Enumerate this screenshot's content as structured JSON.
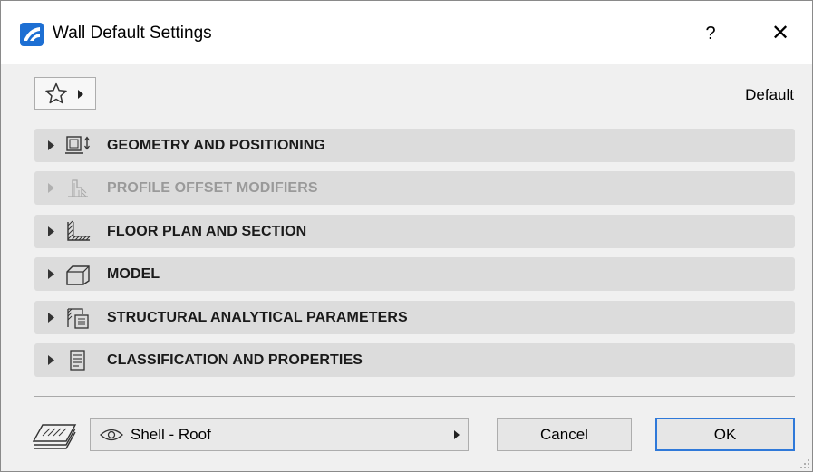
{
  "window": {
    "title": "Wall Default Settings",
    "help_label": "?",
    "close_label": "✕",
    "app_icon": "archicad-logo-icon"
  },
  "header": {
    "favorites_icon": "star-icon",
    "preset_label": "Default"
  },
  "panels": [
    {
      "label": "GEOMETRY AND POSITIONING",
      "icon": "geometry-icon",
      "enabled": true
    },
    {
      "label": "PROFILE OFFSET MODIFIERS",
      "icon": "profile-offset-icon",
      "enabled": false
    },
    {
      "label": "FLOOR PLAN AND SECTION",
      "icon": "floor-plan-icon",
      "enabled": true
    },
    {
      "label": "MODEL",
      "icon": "model-icon",
      "enabled": true
    },
    {
      "label": "STRUCTURAL ANALYTICAL PARAMETERS",
      "icon": "structural-icon",
      "enabled": true
    },
    {
      "label": "CLASSIFICATION AND PROPERTIES",
      "icon": "classification-icon",
      "enabled": true
    }
  ],
  "footer": {
    "layer_value": "Shell - Roof",
    "cancel_label": "Cancel",
    "ok_label": "OK"
  },
  "colors": {
    "accent": "#2f79d9",
    "panel_bg": "#dcdcdc",
    "dialog_bg": "#f0f0f0"
  }
}
